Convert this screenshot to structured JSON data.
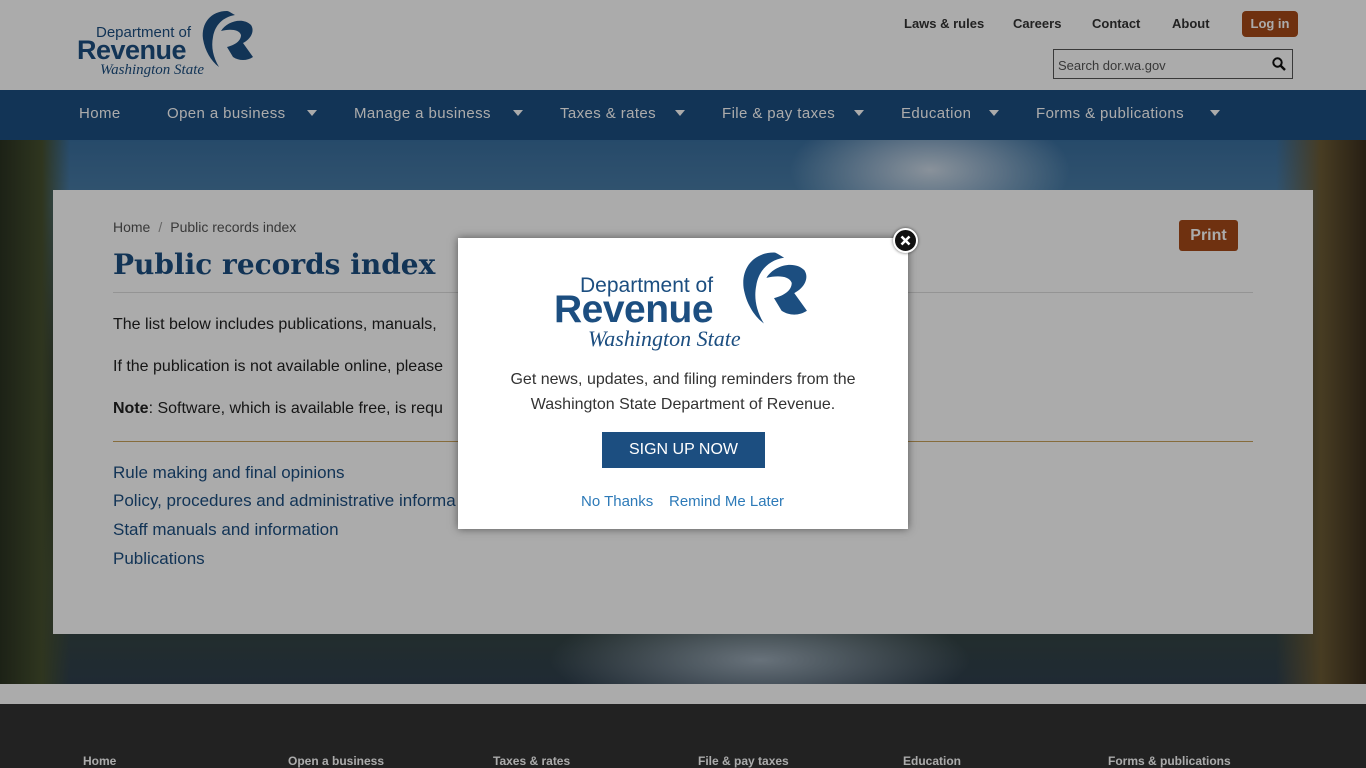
{
  "header": {
    "logo": {
      "line1": "Department of",
      "line2": "Revenue",
      "line3": "Washington State"
    },
    "utility": [
      "Laws & rules",
      "Careers",
      "Contact",
      "About"
    ],
    "login_label": "Log in",
    "search_placeholder": "Search dor.wa.gov"
  },
  "nav": {
    "items": [
      "Home",
      "Open a business",
      "Manage a business",
      "Taxes & rates",
      "File & pay taxes",
      "Education",
      "Forms & publications"
    ]
  },
  "content": {
    "breadcrumb": [
      "Home",
      "Public records index"
    ],
    "print_label": "Print",
    "title": "Public records index",
    "para1": "The list below includes publications, manuals,",
    "para2": "If the publication is not available online, please",
    "note_label": "Note",
    "note_text": ": Software, which is available free, is requ",
    "links": [
      "Rule making and final opinions",
      "Policy, procedures and administrative informa",
      "Staff manuals and information",
      "Publications"
    ]
  },
  "footer": {
    "links": [
      "Home",
      "Open a business",
      "Taxes & rates",
      "File & pay taxes",
      "Education",
      "Forms & publications"
    ]
  },
  "modal": {
    "logo": {
      "line1": "Department of",
      "line2": "Revenue",
      "line3": "Washington State"
    },
    "message": "Get news, updates, and filing reminders from the Washington State Department of Revenue.",
    "signup_label": "SIGN UP NOW",
    "no_thanks_label": "No Thanks",
    "remind_label": "Remind Me Later"
  },
  "colors": {
    "brand_blue": "#1c4e80",
    "accent_orange": "#a64a18",
    "link_blue": "#2d7ab8",
    "footer_bg": "#333333"
  }
}
